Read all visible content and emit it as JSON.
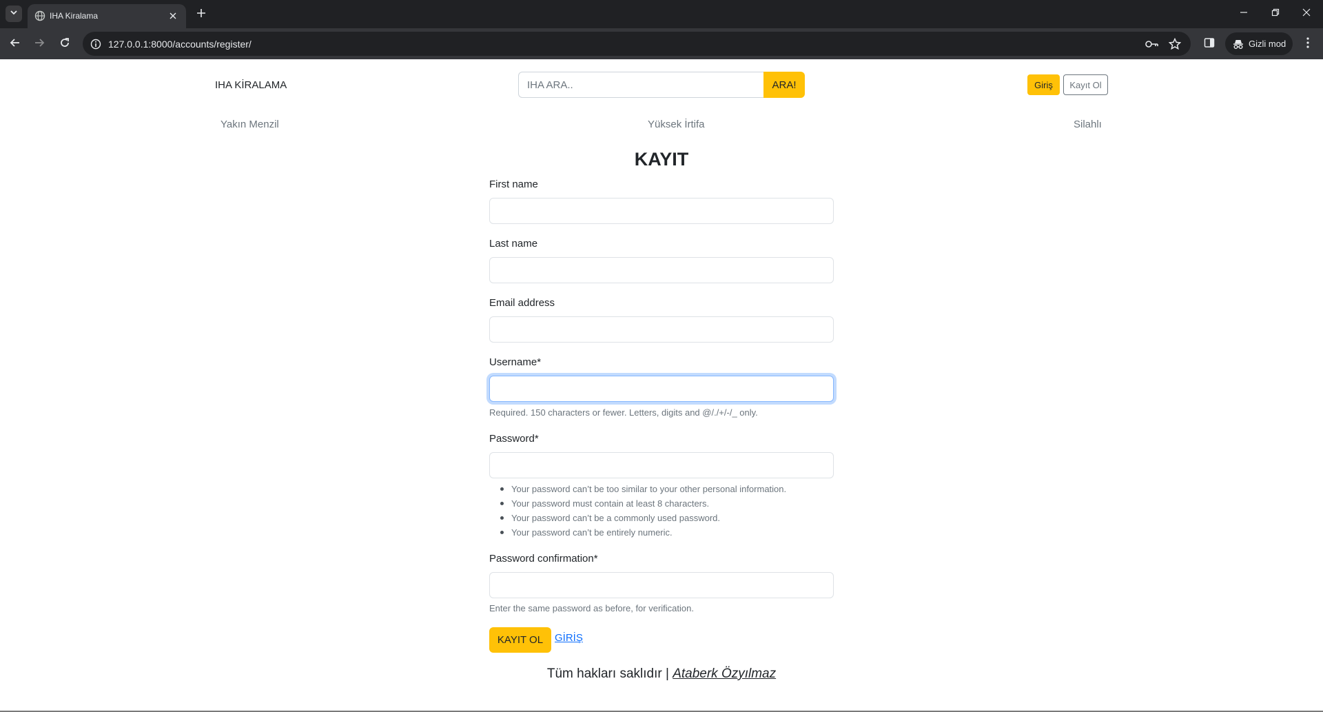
{
  "browser": {
    "tab_title": "IHA Kiralama",
    "url": "127.0.0.1:8000/accounts/register/",
    "incognito_label": "Gizli mod",
    "icons": [
      "tab-search-icon",
      "globe-icon",
      "close-icon",
      "plus-icon",
      "minimize-icon",
      "restore-icon",
      "back-arrow-icon",
      "forward-arrow-icon",
      "reload-icon",
      "info-icon",
      "key-icon",
      "star-icon",
      "side-panel-icon",
      "incognito-icon",
      "kebab-menu-icon"
    ]
  },
  "header": {
    "brand": "IHA KİRALAMA",
    "search_placeholder": "IHA ARA..",
    "search_button": "ARA!",
    "login_button": "Giriş",
    "register_button": "Kayıt Ol"
  },
  "categories": [
    "Yakın Menzil",
    "Yüksek İrtifa",
    "Silahlı"
  ],
  "form": {
    "title": "KAYIT",
    "fields": [
      {
        "label": "First name",
        "value": ""
      },
      {
        "label": "Last name",
        "value": ""
      },
      {
        "label": "Email address",
        "value": ""
      },
      {
        "label": "Username*",
        "value": "",
        "help": "Required. 150 characters or fewer. Letters, digits and @/./+/-/_ only."
      },
      {
        "label": "Password*",
        "value": ""
      },
      {
        "label": "Password confirmation*",
        "value": "",
        "help": "Enter the same password as before, for verification."
      }
    ],
    "password_rules": [
      "Your password can’t be too similar to your other personal information.",
      "Your password must contain at least 8 characters.",
      "Your password can’t be a commonly used password.",
      "Your password can’t be entirely numeric."
    ],
    "submit_label": "KAYIT OL",
    "login_link": "GİRİŞ"
  },
  "footer": {
    "text": "Tüm hakları saklıdır | ",
    "author": "Ataberk Özyılmaz"
  },
  "colors": {
    "accent": "#ffc107",
    "link": "#0d6efd",
    "chrome_dark": "#202124",
    "chrome_toolbar": "#35363a"
  }
}
